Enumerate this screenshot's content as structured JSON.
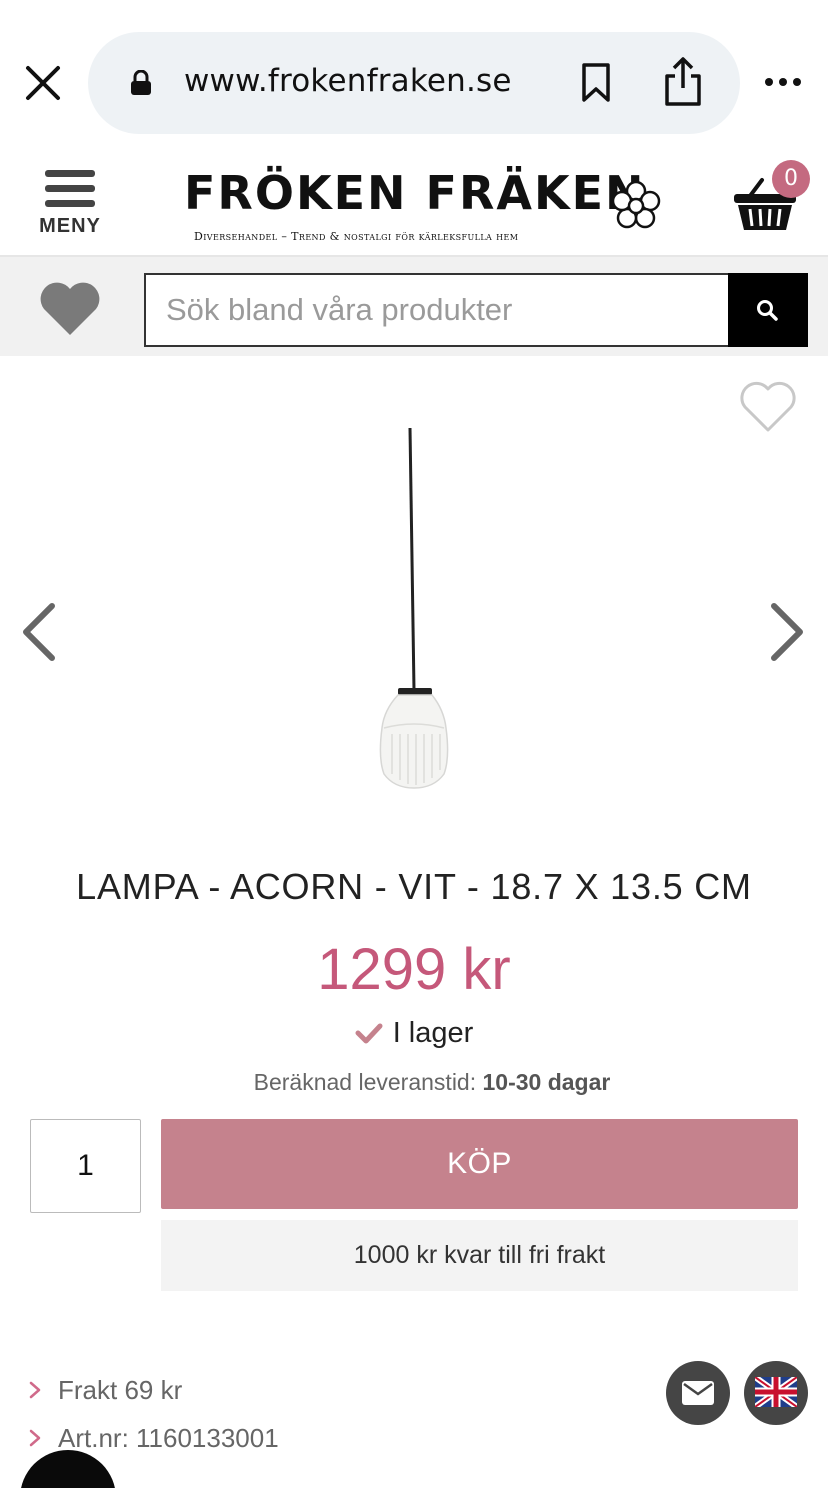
{
  "browser": {
    "url": "www.frokenfraken.se",
    "close_icon": "close-icon",
    "lock_icon": "lock-icon",
    "bookmark_icon": "bookmark-icon",
    "share_icon": "share-icon",
    "more_icon": "more-icon"
  },
  "header": {
    "menu_label": "MENY",
    "logo_title": "FRÖKEN FRÄKEN",
    "logo_tagline": "Diversehandel – Trend & nostalgi för kärleksfulla hem",
    "cart_count": "0"
  },
  "search": {
    "placeholder": "Sök bland våra produkter",
    "value": ""
  },
  "product": {
    "title": "LAMPA - ACORN - VIT - 18.7 X 13.5 CM",
    "price": "1299 kr",
    "stock": "I lager",
    "delivery_label": "Beräknad leveranstid:",
    "delivery_value": "10-30 dagar",
    "quantity": "1",
    "buy_label": "KÖP",
    "free_shipping": "1000 kr kvar till fri frakt"
  },
  "info": {
    "items": [
      {
        "label": "Frakt 69 kr"
      },
      {
        "label": "Art.nr: 1160133001"
      }
    ]
  },
  "colors": {
    "accent_price": "#c5587a",
    "buy_button": "#c5828d",
    "badge": "#c46a80"
  }
}
